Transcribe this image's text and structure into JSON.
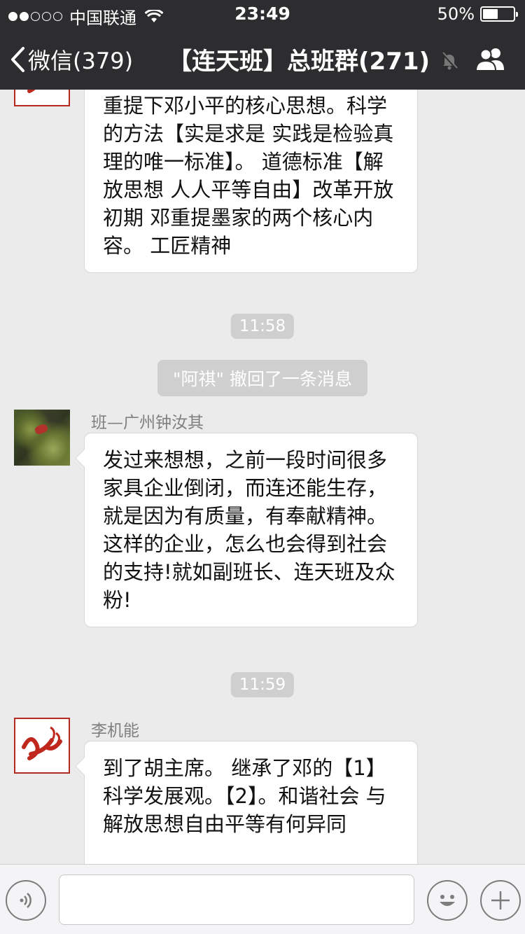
{
  "status_bar": {
    "carrier": "中国联通",
    "time": "23:49",
    "battery": "50%",
    "battery_level": 0.5
  },
  "nav": {
    "back_label": "微信(379)",
    "title": "【连天班】总班群(271)"
  },
  "messages": {
    "m1": {
      "text": "重提下邓小平的核心思想。科学的方法【实是求是  实践是检验真理的唯一标准】。 道德标准【解放思想 人人平等自由】改革开放初期   邓重提墨家的两个核心内容。 工匠精神"
    },
    "time1": "11:58",
    "system_notice": "\"阿祺\" 撤回了一条消息",
    "m2": {
      "sender": "班—广州钟汝其",
      "text": "发过来想想，之前一段时间很多家具企业倒闭，而连还能生存，就是因为有质量，有奉献精神。这样的企业，怎么也会得到社会的支持!就如副班长、连天班及众粉!"
    },
    "time2": "11:59",
    "m3": {
      "sender": "李机能",
      "text": "到了胡主席。 继承了邓的【1】科学发展观。【2】。和谐社会   与解放思想自由平等有何异同"
    }
  },
  "colors": {
    "nav_bg": "#2d2d2f",
    "chat_bg": "#ebebeb",
    "seal_red": "#b52a1f",
    "pill_bg": "#cfcfcf"
  },
  "icons": [
    "back-chevron-icon",
    "mute-bell-icon",
    "group-members-icon",
    "wifi-icon",
    "voice-icon",
    "emoji-icon",
    "plus-icon",
    "seal-avatar"
  ]
}
